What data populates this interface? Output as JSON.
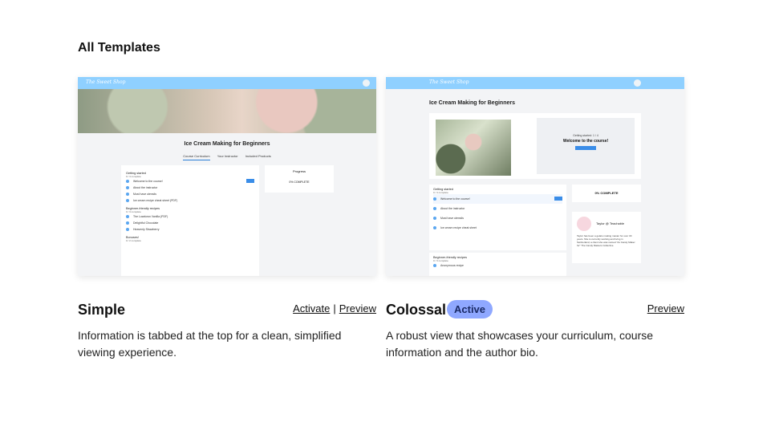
{
  "page": {
    "title": "All Templates"
  },
  "templates": [
    {
      "name": "Simple",
      "actions": {
        "activate": "Activate",
        "separator": "|",
        "preview": "Preview"
      },
      "description": "Information is tabbed at the top for a clean, simplified viewing experience.",
      "thumbnail": {
        "logo": "The Sweet Shop",
        "course_title": "Ice Cream Making for Beginners",
        "tabs": [
          "Course Curriculum",
          "Your Instructor",
          "Included Products"
        ],
        "sections": [
          {
            "title": "Getting started",
            "meta": "0 / 4 complete",
            "lessons": [
              "Welcome to the course!",
              "About the instructor",
              "Must have utensils",
              "Ice cream recipe cheat sheet (PDF)"
            ]
          },
          {
            "title": "Beginner-friendly recipes",
            "meta": "0 / 3 complete",
            "lessons": [
              "The Lowdown Vanilla (PDF)",
              "Delightful Chocolate",
              "Heavenly Strawberry"
            ]
          },
          {
            "title": "Bonuses!",
            "meta": "0 / 2 complete",
            "lessons": []
          }
        ],
        "progress_label": "Progress",
        "progress_value": "0% COMPLETE"
      }
    },
    {
      "name": "Colossal",
      "badge": "Active",
      "actions": {
        "preview": "Preview"
      },
      "description": "A robust view that showcases your curriculum, course information and the author bio.",
      "thumbnail": {
        "logo": "The Sweet Shop",
        "course_title": "Ice Cream Making for Beginners",
        "welcome_small": "Getting started: 1 / 4",
        "welcome": "Welcome to the course!",
        "welcome_button": "Start Lesson",
        "sections": [
          {
            "title": "Getting started",
            "meta": "0 / 4 complete",
            "lessons": [
              "Welcome to the course!",
              "About the instructor",
              "Must have utensils",
              "Ice cream recipe cheat sheet"
            ]
          },
          {
            "title": "Beginner-friendly recipes",
            "meta": "0 / 3 complete",
            "lessons": [
              "Anonymous recipe"
            ]
          }
        ],
        "progress_value": "0% COMPLETE",
        "author_name": "Taylor @ Teachable",
        "author_bio": "Taylor has been a gelato making master for over 30 years. She is currently working and living in Switzerland, a client she was named \"As Candy Maker for\" The Candy Masters Collective."
      }
    }
  ]
}
